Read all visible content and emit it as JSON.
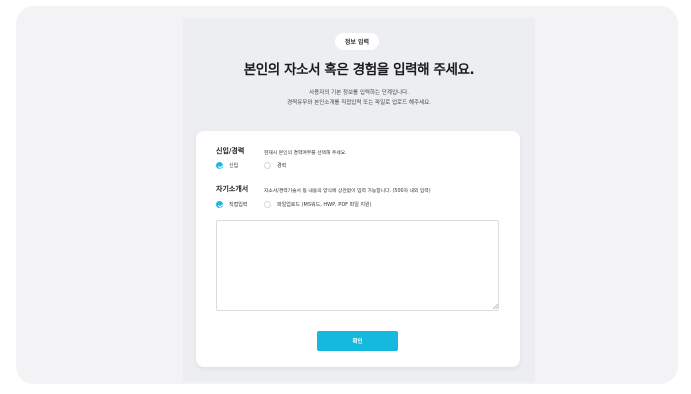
{
  "header": {
    "badge": "정보 입력",
    "title": "본인의 자소서 혹은 경험을 입력해 주세요.",
    "desc_line1": "사용자의 기본 정보를 입력하는 단계입니다.",
    "desc_line2": "경력유무와 본인소개를 직접입력 또는 파일로 업로드 해주세요."
  },
  "career": {
    "label": "신입/경력",
    "hint": "현재시 본인의 경력여부를 선택해 주세요.",
    "options": [
      {
        "label": "신입",
        "selected": true
      },
      {
        "label": "경력",
        "selected": false
      }
    ]
  },
  "intro": {
    "label": "자기소개서",
    "hint": "자소서/경력기술서 등 내용의 양식에 상관없이 입력 가능합니다. (500자 내외 입력)",
    "options": [
      {
        "label": "직접입력",
        "selected": true
      },
      {
        "label": "파일업로드 (MS워드, HWP, PDF 파일 지원)",
        "selected": false
      }
    ],
    "textarea_value": ""
  },
  "actions": {
    "confirm_label": "확인"
  },
  "colors": {
    "accent": "#15b9de",
    "panel_bg": "#eceef2",
    "outer_bg": "#f3f3f5"
  }
}
